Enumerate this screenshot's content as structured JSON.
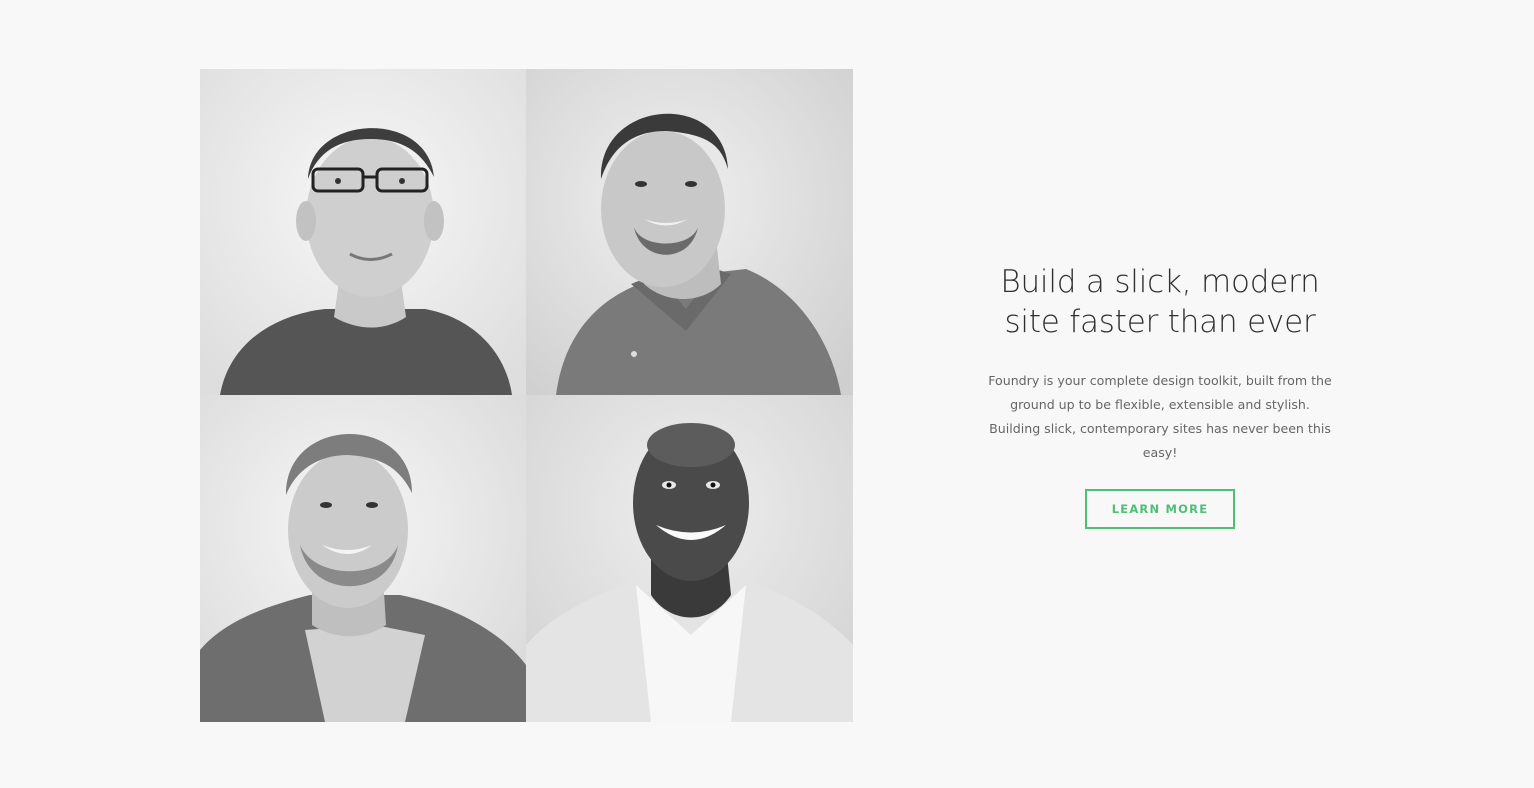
{
  "hero": {
    "headline_line1": "Build a slick, modern",
    "headline_line2": "site faster than ever",
    "body": "Foundry is your complete design toolkit, built from the ground up to be flexible, extensible and stylish. Building slick, contemporary sites has never been this easy!",
    "cta_label": "LEARN MORE"
  },
  "colors": {
    "background": "#f8f8f8",
    "accent": "#4ebf75",
    "headline": "#2f2f2f",
    "body": "#666666"
  }
}
